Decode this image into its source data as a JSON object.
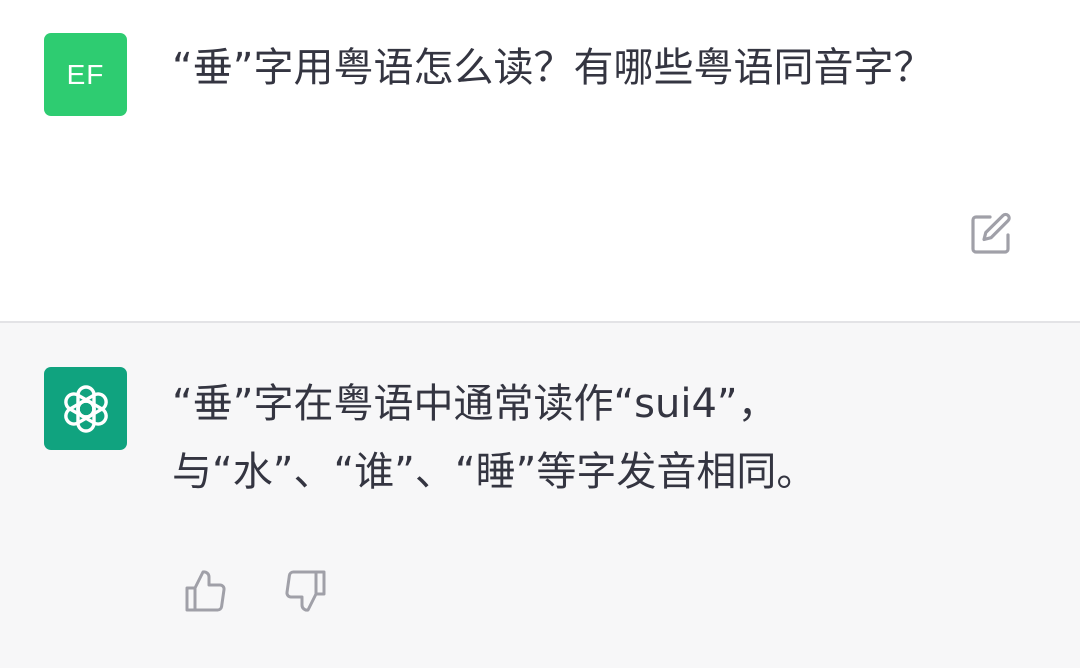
{
  "colors": {
    "user_avatar_bg": "#2ecc71",
    "bot_avatar_bg": "#10a37f",
    "text": "#343541",
    "icon": "#a0a0a8"
  },
  "user_message": {
    "avatar_initials": "EF",
    "text": "“垂”字用粤语怎么读？有哪些粤语同音字？",
    "edit_icon": "edit-icon"
  },
  "assistant_message": {
    "avatar_icon": "openai-logo-icon",
    "text": "“垂”字在粤语中通常读作“sui4”，与“水”、“谁”、“睡”等字发音相同。",
    "feedback": {
      "thumbs_up_icon": "thumbs-up-icon",
      "thumbs_down_icon": "thumbs-down-icon"
    }
  }
}
